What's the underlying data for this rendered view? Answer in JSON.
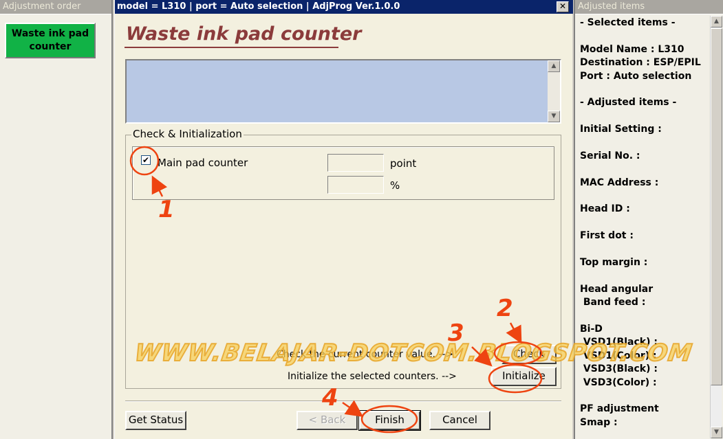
{
  "left_panel": {
    "title": "Adjustment order",
    "items": [
      {
        "label_line1": "Waste ink pad",
        "label_line2": "counter"
      }
    ]
  },
  "window": {
    "title": "model = L310 | port = Auto selection | AdjProg Ver.1.0.0",
    "close_glyph": "✕"
  },
  "main": {
    "heading": "Waste ink pad counter",
    "group_label": "Check & Initialization",
    "counter": {
      "label": "Main pad counter",
      "checked": true,
      "check_glyph": "✔",
      "point_value": "",
      "point_unit": "point",
      "percent_value": "",
      "percent_unit": "%"
    },
    "check_text": "Check the current counter value. -->",
    "check_button": "Check",
    "initialize_text": "Initialize the selected counters. -->",
    "initialize_button": "Initialize"
  },
  "footer": {
    "get_status": "Get Status",
    "back": "< Back",
    "finish": "Finish",
    "cancel": "Cancel"
  },
  "right_panel": {
    "title": "Adjusted items",
    "lines": [
      "- Selected items -",
      "",
      "Model Name : L310",
      "Destination : ESP/EPIL",
      "Port : Auto selection",
      "",
      "- Adjusted items -",
      "",
      "Initial Setting :",
      "",
      "Serial No. :",
      "",
      "MAC Address :",
      "",
      "Head ID :",
      "",
      "First dot :",
      "",
      "Top margin :",
      "",
      "Head angular",
      " Band feed :",
      "",
      "Bi-D",
      " VSD1(Black) :",
      " VSD1(Color) :",
      " VSD3(Black) :",
      " VSD3(Color) :",
      "",
      "PF adjustment",
      "Smap :"
    ]
  },
  "annotations": {
    "watermark": "WWW.BELAJAR-DOTCOM.BLOGSPOT.COM",
    "step_labels": [
      "1",
      "2",
      "3",
      "4"
    ],
    "color": "#ee4411"
  },
  "icons": {
    "scroll_up": "up-arrow-icon",
    "scroll_down": "down-arrow-icon",
    "close": "close-icon",
    "checkmark": "checkmark-icon"
  }
}
